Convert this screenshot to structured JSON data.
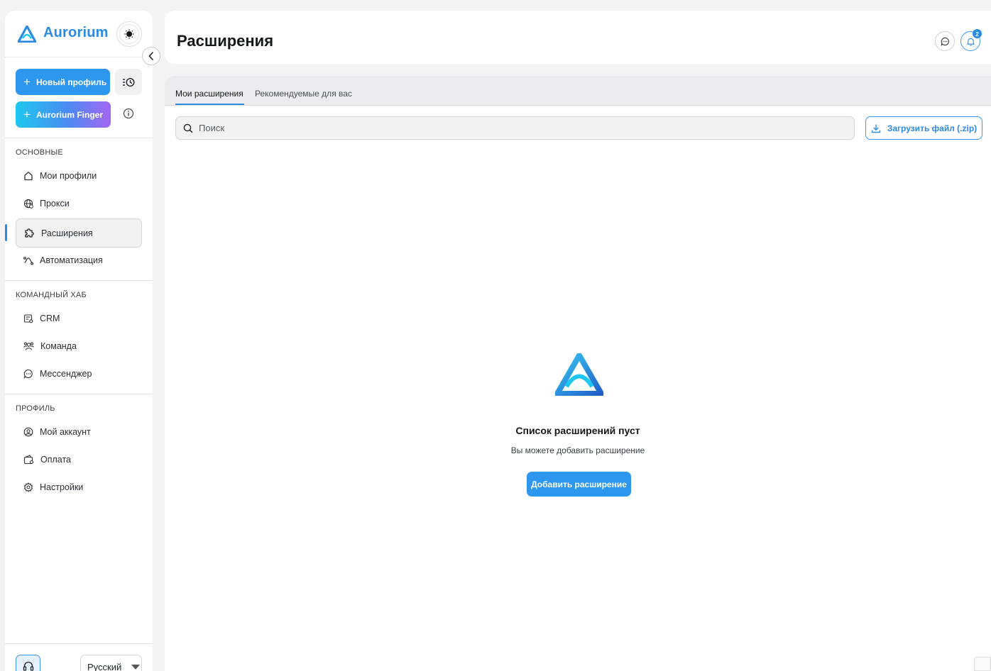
{
  "brand": {
    "name": "Aurorium",
    "accent": "#2a8be4"
  },
  "sidebar": {
    "new_profile_label": "Новый профиль",
    "finger_label": "Aurorium Finger",
    "sections": [
      {
        "title": "ОСНОВНЫЕ",
        "items": [
          {
            "label": "Мои профили",
            "icon": "home-icon"
          },
          {
            "label": "Прокси",
            "icon": "globe-icon"
          },
          {
            "label": "Расширения",
            "icon": "puzzle-icon",
            "active": true
          },
          {
            "label": "Автоматизация",
            "icon": "automation-icon"
          }
        ]
      },
      {
        "title": "КОМАНДНЫЙ ХАБ",
        "items": [
          {
            "label": "CRM",
            "icon": "crm-icon"
          },
          {
            "label": "Команда",
            "icon": "team-icon"
          },
          {
            "label": "Мессенджер",
            "icon": "chat-icon"
          }
        ]
      },
      {
        "title": "ПРОФИЛЬ",
        "items": [
          {
            "label": "Мой аккаунт",
            "icon": "user-circle-icon"
          },
          {
            "label": "Оплата",
            "icon": "wallet-icon"
          },
          {
            "label": "Настройки",
            "icon": "gear-icon"
          }
        ]
      }
    ],
    "language": "Русский"
  },
  "header": {
    "title": "Расширения",
    "notification_count": "2"
  },
  "main": {
    "tabs": [
      {
        "label": "Мои расширения",
        "active": true
      },
      {
        "label": "Рекомендуемые для вас",
        "active": false
      }
    ],
    "search_placeholder": "Поиск",
    "upload_label": "Загрузить файл (.zip)",
    "empty_title": "Список расширений пуст",
    "empty_subtitle": "Вы можете добавить расширение",
    "add_button_label": "Добавить расширение"
  }
}
